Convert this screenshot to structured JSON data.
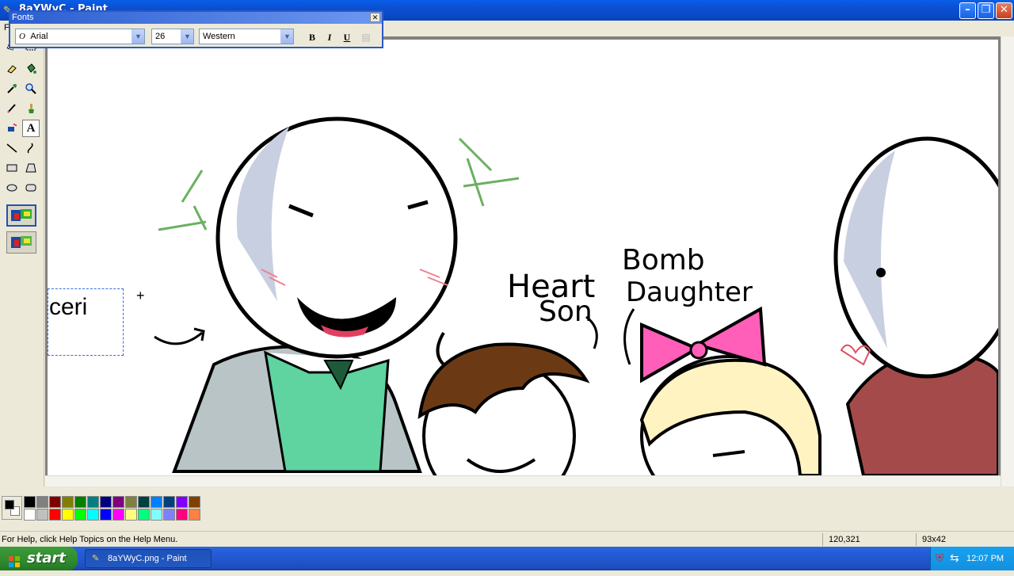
{
  "window": {
    "title": "8aYWyC.png - Paint",
    "title_visible": "8aYWyC - Paint"
  },
  "menu": {
    "items": [
      "F"
    ]
  },
  "fonts_toolbar": {
    "title": "Fonts",
    "font_name": "Arial",
    "font_size": "26",
    "script": "Western",
    "bold_label": "B",
    "italic_label": "I",
    "underline_label": "U"
  },
  "canvas": {
    "text_box_content": "ceri",
    "labels": {
      "heart": "Heart",
      "son": "Son",
      "bomb": "Bomb",
      "daughter": "Daughter"
    }
  },
  "palette": {
    "foreground": "#000000",
    "background": "#ffffff",
    "colors_row1": [
      "#000000",
      "#808080",
      "#800000",
      "#808000",
      "#008000",
      "#008080",
      "#000080",
      "#800080",
      "#808040",
      "#004040",
      "#0080ff",
      "#004080",
      "#8000ff",
      "#804000"
    ],
    "colors_row2": [
      "#ffffff",
      "#c0c0c0",
      "#ff0000",
      "#ffff00",
      "#00ff00",
      "#00ffff",
      "#0000ff",
      "#ff00ff",
      "#ffff80",
      "#00ff80",
      "#80ffff",
      "#8080ff",
      "#ff0080",
      "#ff8040"
    ]
  },
  "status": {
    "help_text": "For Help, click Help Topics on the Help Menu.",
    "cursor_pos": "120,321",
    "selection_size": "93x42"
  },
  "taskbar": {
    "start_label": "start",
    "task_label": "8aYWyC.png - Paint",
    "clock": "12:07 PM"
  },
  "tools": [
    "free-form-select",
    "select",
    "eraser",
    "fill",
    "pick-color",
    "magnifier",
    "pencil",
    "brush",
    "airbrush",
    "text",
    "line",
    "curve",
    "rectangle",
    "polygon",
    "ellipse",
    "rounded-rectangle"
  ]
}
